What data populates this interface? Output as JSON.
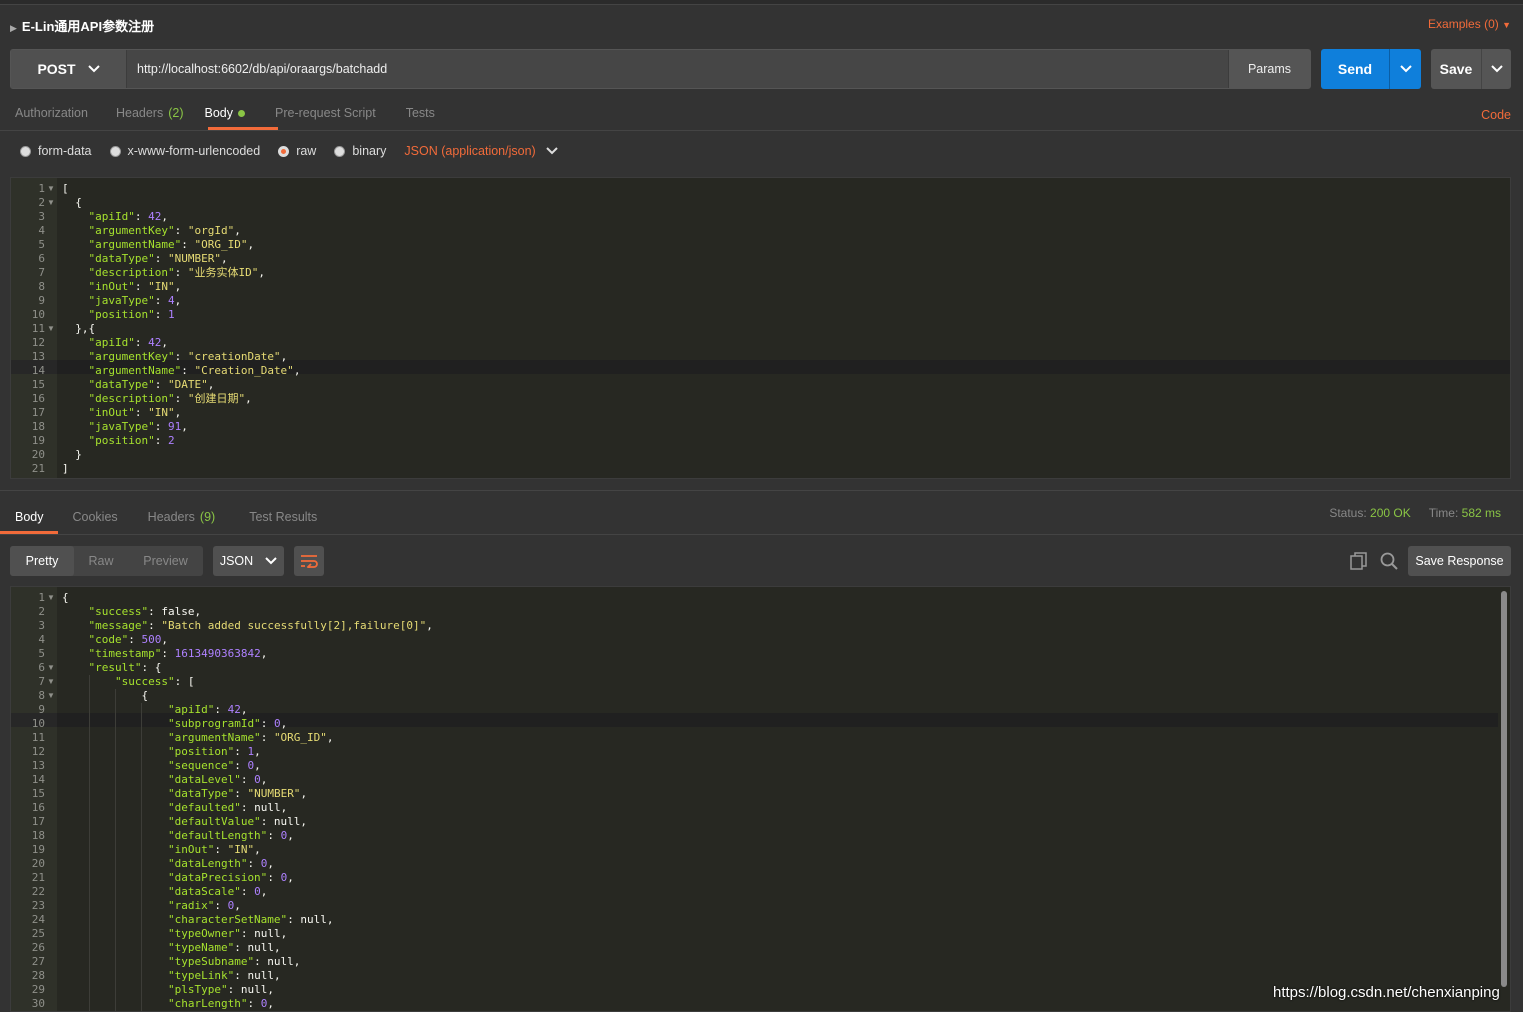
{
  "request": {
    "title": "E-Lin通用API参数注册",
    "examples_label": "Examples (0)",
    "method": "POST",
    "url": "http://localhost:6602/db/api/oraargs/batchadd",
    "params_label": "Params",
    "send_label": "Send",
    "save_label": "Save",
    "tabs": [
      {
        "label": "Authorization"
      },
      {
        "label": "Headers",
        "count": "(2)"
      },
      {
        "label": "Body"
      },
      {
        "label": "Pre-request Script"
      },
      {
        "label": "Tests"
      }
    ],
    "active_tab": "Body",
    "code_label": "Code",
    "body_types": [
      "form-data",
      "x-www-form-urlencoded",
      "raw",
      "binary"
    ],
    "body_type_selected": "raw",
    "content_type": "JSON (application/json)",
    "body_lines": [
      "[",
      "  {",
      "    \"apiId\": 42,",
      "    \"argumentKey\": \"orgId\",",
      "    \"argumentName\": \"ORG_ID\",",
      "    \"dataType\": \"NUMBER\",",
      "    \"description\": \"业务实体ID\",",
      "    \"inOut\": \"IN\",",
      "    \"javaType\": 4,",
      "    \"position\": 1",
      "  },{",
      "    \"apiId\": 42,",
      "    \"argumentKey\": \"creationDate\",",
      "    \"argumentName\": \"Creation_Date\",",
      "    \"dataType\": \"DATE\",",
      "    \"description\": \"创建日期\",",
      "    \"inOut\": \"IN\",",
      "    \"javaType\": 91,",
      "    \"position\": 2",
      "  }",
      "]"
    ]
  },
  "response": {
    "tabs": [
      {
        "label": "Body"
      },
      {
        "label": "Cookies"
      },
      {
        "label": "Headers",
        "count": "(9)"
      },
      {
        "label": "Test Results"
      }
    ],
    "active_tab": "Body",
    "status_label": "Status:",
    "status_value": "200 OK",
    "time_label": "Time:",
    "time_value": "582 ms",
    "view_modes": [
      "Pretty",
      "Raw",
      "Preview"
    ],
    "view_selected": "Pretty",
    "format": "JSON",
    "save_response_label": "Save Response",
    "body_lines": [
      "{",
      "    \"success\": false,",
      "    \"message\": \"Batch added successfully[2],failure[0]\",",
      "    \"code\": 500,",
      "    \"timestamp\": 1613490363842,",
      "    \"result\": {",
      "        \"success\": [",
      "            {",
      "                \"apiId\": 42,",
      "                \"subprogramId\": 0,",
      "                \"argumentName\": \"ORG_ID\",",
      "                \"position\": 1,",
      "                \"sequence\": 0,",
      "                \"dataLevel\": 0,",
      "                \"dataType\": \"NUMBER\",",
      "                \"defaulted\": null,",
      "                \"defaultValue\": null,",
      "                \"defaultLength\": 0,",
      "                \"inOut\": \"IN\",",
      "                \"dataLength\": 0,",
      "                \"dataPrecision\": 0,",
      "                \"dataScale\": 0,",
      "                \"radix\": 0,",
      "                \"characterSetName\": null,",
      "                \"typeOwner\": null,",
      "                \"typeName\": null,",
      "                \"typeSubname\": null,",
      "                \"typeLink\": null,",
      "                \"plsType\": null,",
      "                \"charLength\": 0,"
    ]
  },
  "watermark": "https://blog.csdn.net/chenxianping"
}
